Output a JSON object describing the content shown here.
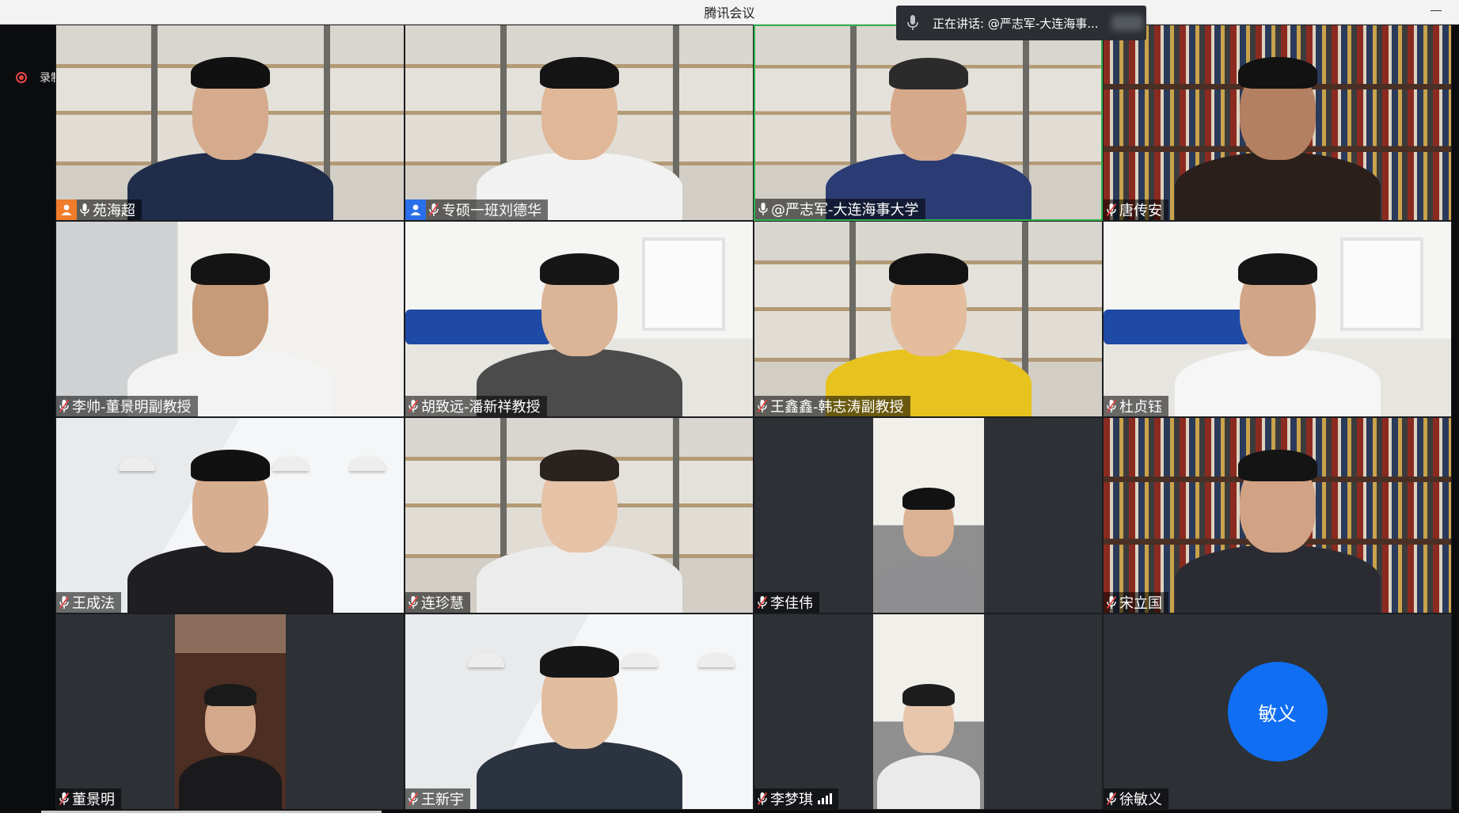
{
  "app": {
    "title": "腾讯会议"
  },
  "speaking": {
    "text": "正在讲话: @严志军-大连海事..."
  },
  "recording": {
    "label": "录制中"
  },
  "accent": {
    "host": "#f07c2c",
    "cohost": "#2a6fea",
    "active": "#2fb24c",
    "avatar": "#0f6ef2",
    "recording": "#e84545"
  },
  "participants": [
    {
      "name": "苑海超",
      "mic": "on",
      "role": "host",
      "bg": "shelf"
    },
    {
      "name": "专硕一班刘德华",
      "mic": "muted",
      "role": "cohost",
      "bg": "shelf"
    },
    {
      "name": "@严志军-大连海事大学",
      "mic": "on",
      "role": "none",
      "bg": "shelf",
      "active": true
    },
    {
      "name": "唐传安",
      "mic": "muted",
      "role": "none",
      "bg": "books"
    },
    {
      "name": "李帅-董景明副教授",
      "mic": "muted",
      "role": "none",
      "bg": "white"
    },
    {
      "name": "胡致远-潘新祥教授",
      "mic": "muted",
      "role": "none",
      "bg": "room"
    },
    {
      "name": "王鑫鑫-韩志涛副教授",
      "mic": "muted",
      "role": "none",
      "bg": "shelf"
    },
    {
      "name": "杜贞钰",
      "mic": "muted",
      "role": "none",
      "bg": "room"
    },
    {
      "name": "王成法",
      "mic": "muted",
      "role": "none",
      "bg": "loft"
    },
    {
      "name": "连珍慧",
      "mic": "muted",
      "role": "none",
      "bg": "shelf"
    },
    {
      "name": "李佳伟",
      "mic": "muted",
      "role": "none",
      "bg": "portrait-light"
    },
    {
      "name": "宋立国",
      "mic": "muted",
      "role": "none",
      "bg": "books"
    },
    {
      "name": "董景明",
      "mic": "muted",
      "role": "none",
      "bg": "portrait-books"
    },
    {
      "name": "王新宇",
      "mic": "muted",
      "role": "none",
      "bg": "loft"
    },
    {
      "name": "李梦琪",
      "mic": "muted",
      "role": "none",
      "bg": "portrait-light",
      "signal": true
    },
    {
      "name": "徐敏义",
      "mic": "muted",
      "role": "none",
      "bg": "avatar",
      "avatar_text": "敏义"
    }
  ]
}
